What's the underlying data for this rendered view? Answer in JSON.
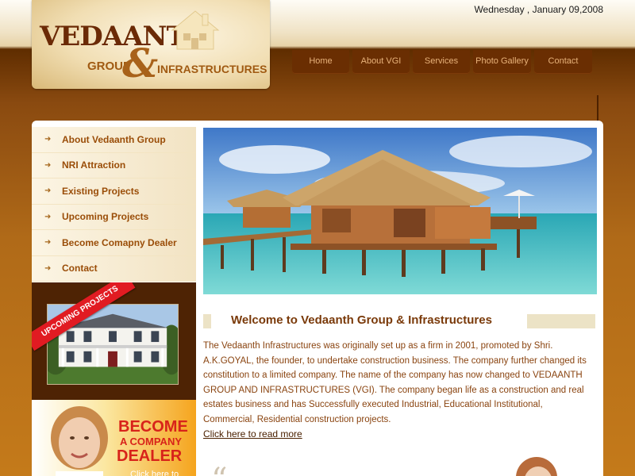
{
  "header": {
    "logo_name": "VEDAANTH",
    "logo_group": "GROUP",
    "logo_amp": "&",
    "logo_infra": "INFRASTRUCTURES",
    "date": "Wednesday , January 09,2008"
  },
  "topnav": {
    "items": [
      {
        "label": "Home"
      },
      {
        "label": "About VGI"
      },
      {
        "label": "Services"
      },
      {
        "label": "Photo Gallery"
      },
      {
        "label": "Contact"
      }
    ]
  },
  "sidebar": {
    "items": [
      {
        "label": "About Vedaanth Group"
      },
      {
        "label": "NRI Attraction"
      },
      {
        "label": "Existing Projects"
      },
      {
        "label": "Upcoming Projects"
      },
      {
        "label": "Become Comapny Dealer"
      },
      {
        "label": "Contact"
      }
    ]
  },
  "upcoming": {
    "ribbon": "UPCOMING PROJECTS"
  },
  "dealer": {
    "become": "BECOME",
    "a_company": "A COMPANY",
    "dealer": "DEALER",
    "click": "Click here to"
  },
  "main": {
    "welcome_title": "Welcome to Vedaanth Group & Infrastructures",
    "intro": "The Vedaanth Infrastructures was originally set up as a firm in 2001, promoted by Shri. A.K.GOYAL, the founder, to undertake construction business. The company further changed its constitution to a limited company. The name of the company has now changed to VEDAANTH GROUP AND INFRASTRUCTURES (VGI). The company began life as a construction and real estates business and has Successfully executed Industrial, Educational Institutional, Commercial, Residential construction projects.",
    "read_more": "Click here to read more"
  },
  "icons": {
    "menu_bullet": "arrow-bullet-icon",
    "quote": "quote-icon"
  },
  "colors": {
    "brand_brown": "#6b2a06",
    "menu_text": "#9a4d08",
    "body_text": "#8a4410",
    "ribbon_red": "#e11b22"
  }
}
